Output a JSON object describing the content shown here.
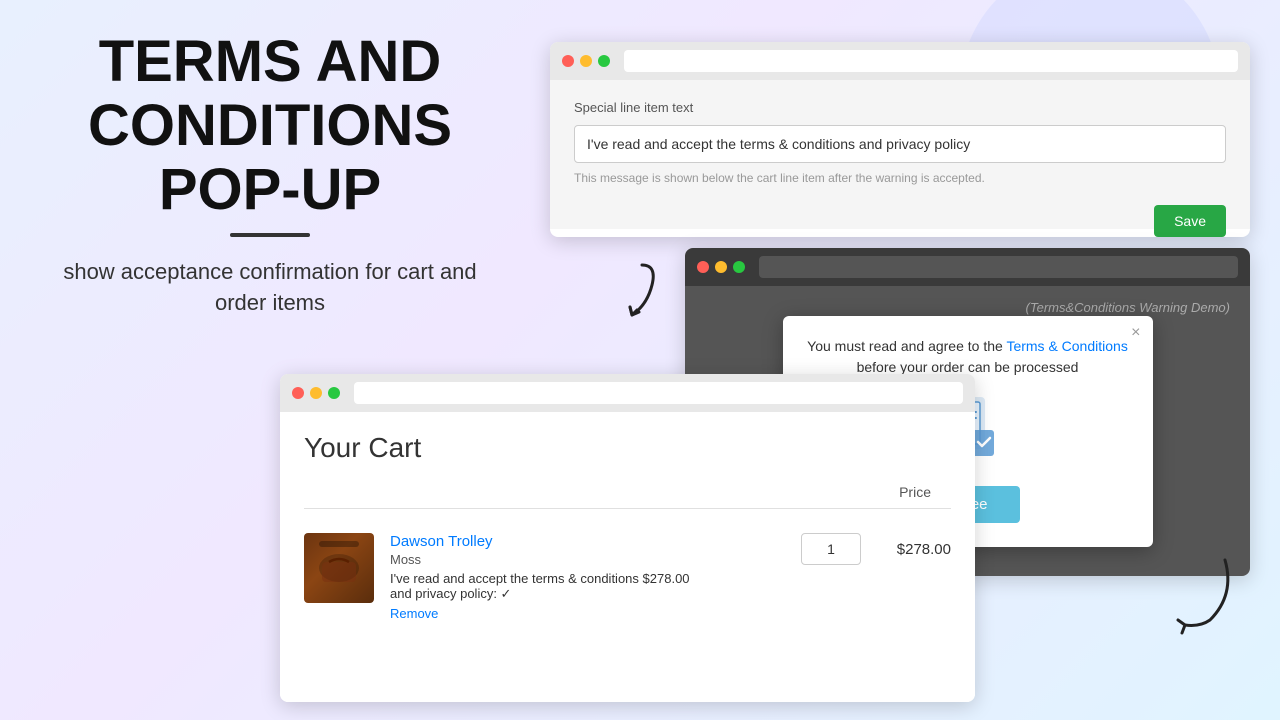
{
  "background": {
    "gradient": "linear-gradient(135deg, #e8f0fe, #f0e8ff, #e0f4ff)"
  },
  "left_panel": {
    "title_line1": "TERMS AND",
    "title_line2": "CONDITIONS",
    "title_line3": "POP-UP",
    "subtitle": "show acceptance confirmation for cart and order items"
  },
  "settings_window": {
    "address_bar_placeholder": "",
    "section_label": "Special line item text",
    "input_value": "I've read and accept the terms & conditions and privacy policy",
    "hint_text": "This message is shown below the cart line item after the warning is accepted.",
    "save_button": "Save"
  },
  "popup_window": {
    "demo_label": "(Terms&Conditions Warning Demo)",
    "modal": {
      "modal_text_prefix": "You must read and agree to the ",
      "modal_link_text": "Terms & Conditions",
      "modal_text_suffix": " before your order can be processed",
      "agree_button": "Agree"
    }
  },
  "cart_window": {
    "title": "Your Cart",
    "price_header": "Price",
    "item": {
      "name": "Dawson Trolley",
      "variant": "Moss",
      "line_item_text": "I've read and accept the terms & conditions",
      "line_item_price": "$278.00",
      "line_item_suffix": "and privacy policy: ✓",
      "quantity": "1",
      "price": "$278.00",
      "remove_label": "Remove"
    }
  }
}
